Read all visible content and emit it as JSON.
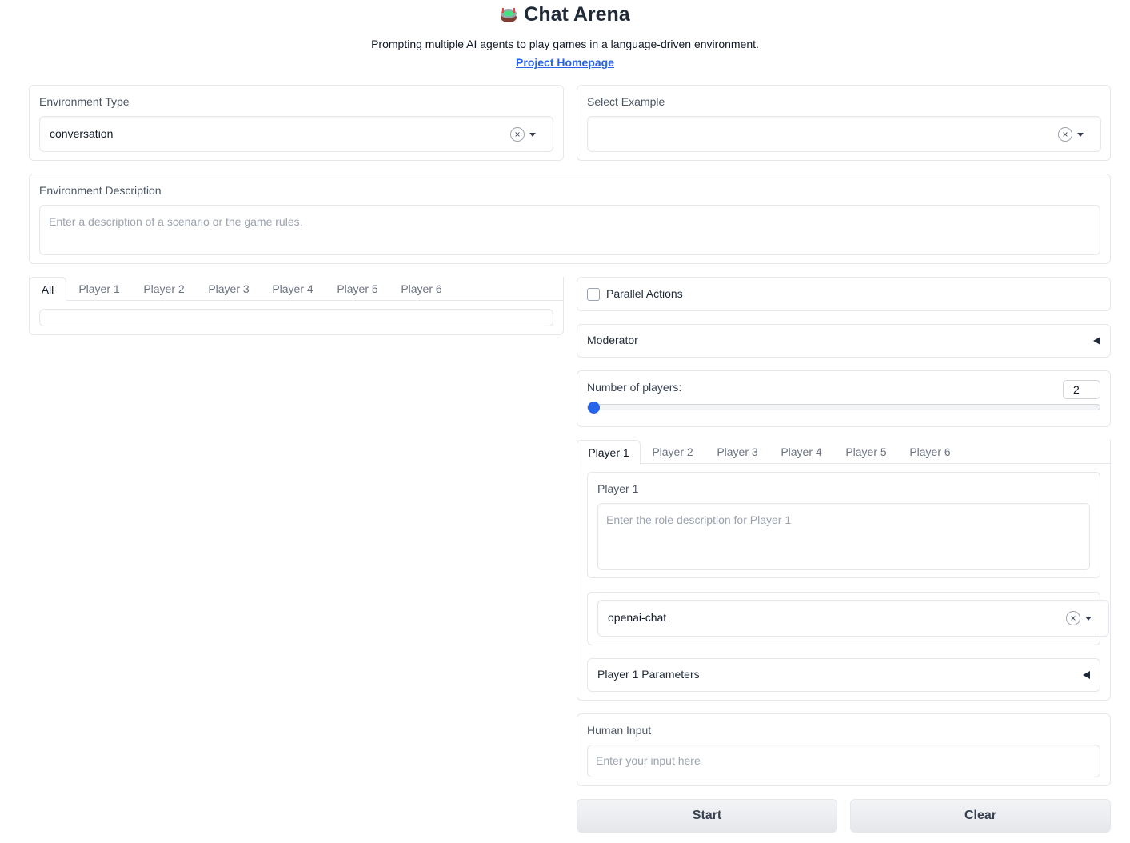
{
  "app": {
    "title": "Chat Arena",
    "subtitle": "Prompting multiple AI agents to play games in a language-driven environment.",
    "homepage_link": "Project Homepage"
  },
  "environment_type": {
    "label": "Environment Type",
    "value": "conversation"
  },
  "select_example": {
    "label": "Select Example",
    "value": ""
  },
  "environment_description": {
    "label": "Environment Description",
    "placeholder": "Enter a description of a scenario or the game rules."
  },
  "chat_tabs": [
    "All",
    "Player 1",
    "Player 2",
    "Player 3",
    "Player 4",
    "Player 5",
    "Player 6"
  ],
  "parallel_actions": {
    "label": "Parallel Actions",
    "checked": false
  },
  "moderator": {
    "label": "Moderator"
  },
  "num_players": {
    "label": "Number of players:",
    "value": "2",
    "level": 0
  },
  "player_tabs": [
    "Player 1",
    "Player 2",
    "Player 3",
    "Player 4",
    "Player 5",
    "Player 6"
  ],
  "player_panel": {
    "label": "Player 1",
    "role_placeholder": "Enter the role description for Player 1",
    "backend": "openai-chat",
    "params_label": "Player 1 Parameters"
  },
  "human_input": {
    "label": "Human Input",
    "placeholder": "Enter your input here"
  },
  "buttons": {
    "start": "Start",
    "clear": "Clear"
  },
  "colors": {
    "accent": "#2563eb",
    "border": "#e5e7eb"
  }
}
